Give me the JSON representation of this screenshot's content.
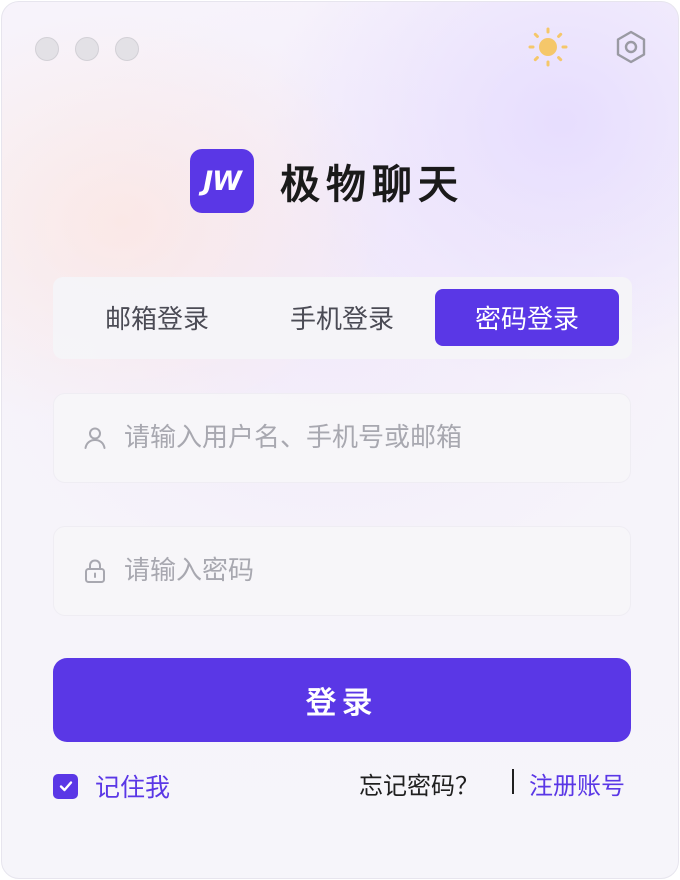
{
  "window": {
    "traffic_lights": [
      "close",
      "minimize",
      "maximize"
    ],
    "theme_icon": "sun-icon",
    "settings_icon": "gear-icon"
  },
  "brand": {
    "logo_text": "JW",
    "app_name": "极物聊天"
  },
  "tabs": [
    {
      "label": "邮箱登录",
      "active": false
    },
    {
      "label": "手机登录",
      "active": false
    },
    {
      "label": "密码登录",
      "active": true
    }
  ],
  "form": {
    "username": {
      "value": "",
      "placeholder": "请输入用户名、手机号或邮箱",
      "icon": "user-icon"
    },
    "password": {
      "value": "",
      "placeholder": "请输入密码",
      "icon": "lock-icon"
    },
    "login_label": "登录"
  },
  "footer": {
    "remember_label": "记住我",
    "remember_checked": true,
    "forgot_label": "忘记密码？",
    "register_label": "注册账号"
  },
  "colors": {
    "accent": "#5a37e6",
    "sun": "#f5c76a",
    "text_dark": "#1a1a1a",
    "placeholder": "#a8a8b0"
  }
}
